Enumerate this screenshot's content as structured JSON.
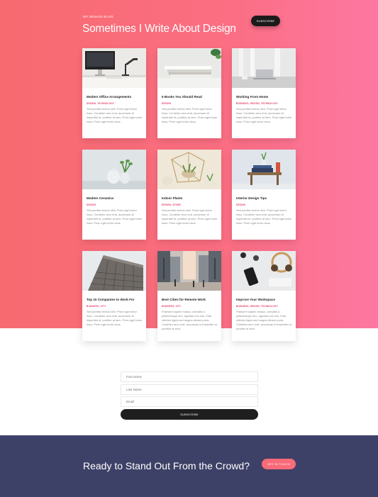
{
  "header": {
    "eyebrow": "MY DESIGN BLOG",
    "title": "Sometimes I Write About Design",
    "subscribe_label": "SUBSCRIBE"
  },
  "posts": [
    {
      "title": "Modern Office Arrangements",
      "tags": "DESIGN, TECHNOLOGY",
      "excerpt": "Sed porttitor lectus nibh. Proin eget tortor risus. Curabitur arcu erat, accumsan id imperdiet et, porttitor at sem. Proin eget tortor risus. Proin eget tortor risus.",
      "image": "office-desk-imac"
    },
    {
      "title": "6 Books You Should Read",
      "tags": "DESIGN",
      "excerpt": "Sed porttitor lectus nibh. Proin eget tortor risus. Curabitur arcu erat, accumsan id imperdiet et, porttitor at sem. Proin eget tortor risus. Proin eget tortor risus.",
      "image": "book-stack"
    },
    {
      "title": "Working From Home",
      "tags": "BUSINESS, DESIGN, TECHNOLOGY",
      "excerpt": "Sed porttitor lectus nibh. Proin eget tortor risus. Curabitur arcu erat, accumsan id imperdiet et, porttitor at sem. Proin eget tortor risus. Proin eget tortor risus.",
      "image": "laptop-window"
    },
    {
      "title": "Modern Ceramics",
      "tags": "DESIGN",
      "excerpt": "Sed porttitor lectus nibh. Proin eget tortor risus. Curabitur arcu erat, accumsan id imperdiet et, porttitor at sem. Proin eget tortor risus. Proin eget tortor risus.",
      "image": "ceramic-vases"
    },
    {
      "title": "Indoor Plants",
      "tags": "DESIGN, STORE",
      "excerpt": "Sed porttitor lectus nibh. Proin eget tortor risus. Curabitur arcu erat, accumsan id imperdiet et, porttitor at sem. Proin eget tortor risus. Proin eget tortor risus.",
      "image": "terrarium-plants"
    },
    {
      "title": "Interior Design Tips",
      "tags": "DESIGN",
      "excerpt": "Sed porttitor lectus nibh. Proin eget tortor risus. Curabitur arcu erat, accumsan id imperdiet et, porttitor at sem. Proin eget tortor risus. Proin eget tortor risus.",
      "image": "books-stool"
    },
    {
      "title": "Top 10 Companies to Work For",
      "tags": "BUSINESS, CITY",
      "excerpt": "Sed porttitor lectus nibh. Proin eget tortor risus. Curabitur arcu erat, accumsan id imperdiet et, porttitor at sem. Proin eget tortor risus. Proin eget tortor risus.",
      "image": "office-building"
    },
    {
      "title": "Best Cities for Remote Work",
      "tags": "BUSINESS, CITY",
      "excerpt": "Praesent sapien massa, convallis a pellentesque nec, egestas non nisi. Cras ultricies ligula sed magna dictum porta. Curabitur arcu erat, accumsan id imperdiet et, porttitor at sem.",
      "image": "city-street"
    },
    {
      "title": "Improve Your Workspace",
      "tags": "BUSINESS, DESIGN, TECHNOLOGY",
      "excerpt": "Praesent sapien massa, convallis a pellentesque nec, egestas non nisi. Cras ultricies ligula sed magna dictum porta. Curabitur arcu erat, accumsan id imperdiet et, porttitor at sem.",
      "image": "desk-headphones-phone"
    }
  ],
  "form": {
    "first_name_placeholder": "First Name",
    "last_name_placeholder": "Last Name",
    "email_placeholder": "Email",
    "subscribe_label": "SUBSCRIBE"
  },
  "footer": {
    "title": "Ready to Stand Out From the Crowd?",
    "cta_label": "GET IN TOUCH"
  },
  "colors": {
    "hero_start": "#f76a6f",
    "hero_end": "#fd77a2",
    "tag_color": "#e4406a",
    "footer_bg": "#3e4167",
    "cta_bg": "#f86b78"
  }
}
